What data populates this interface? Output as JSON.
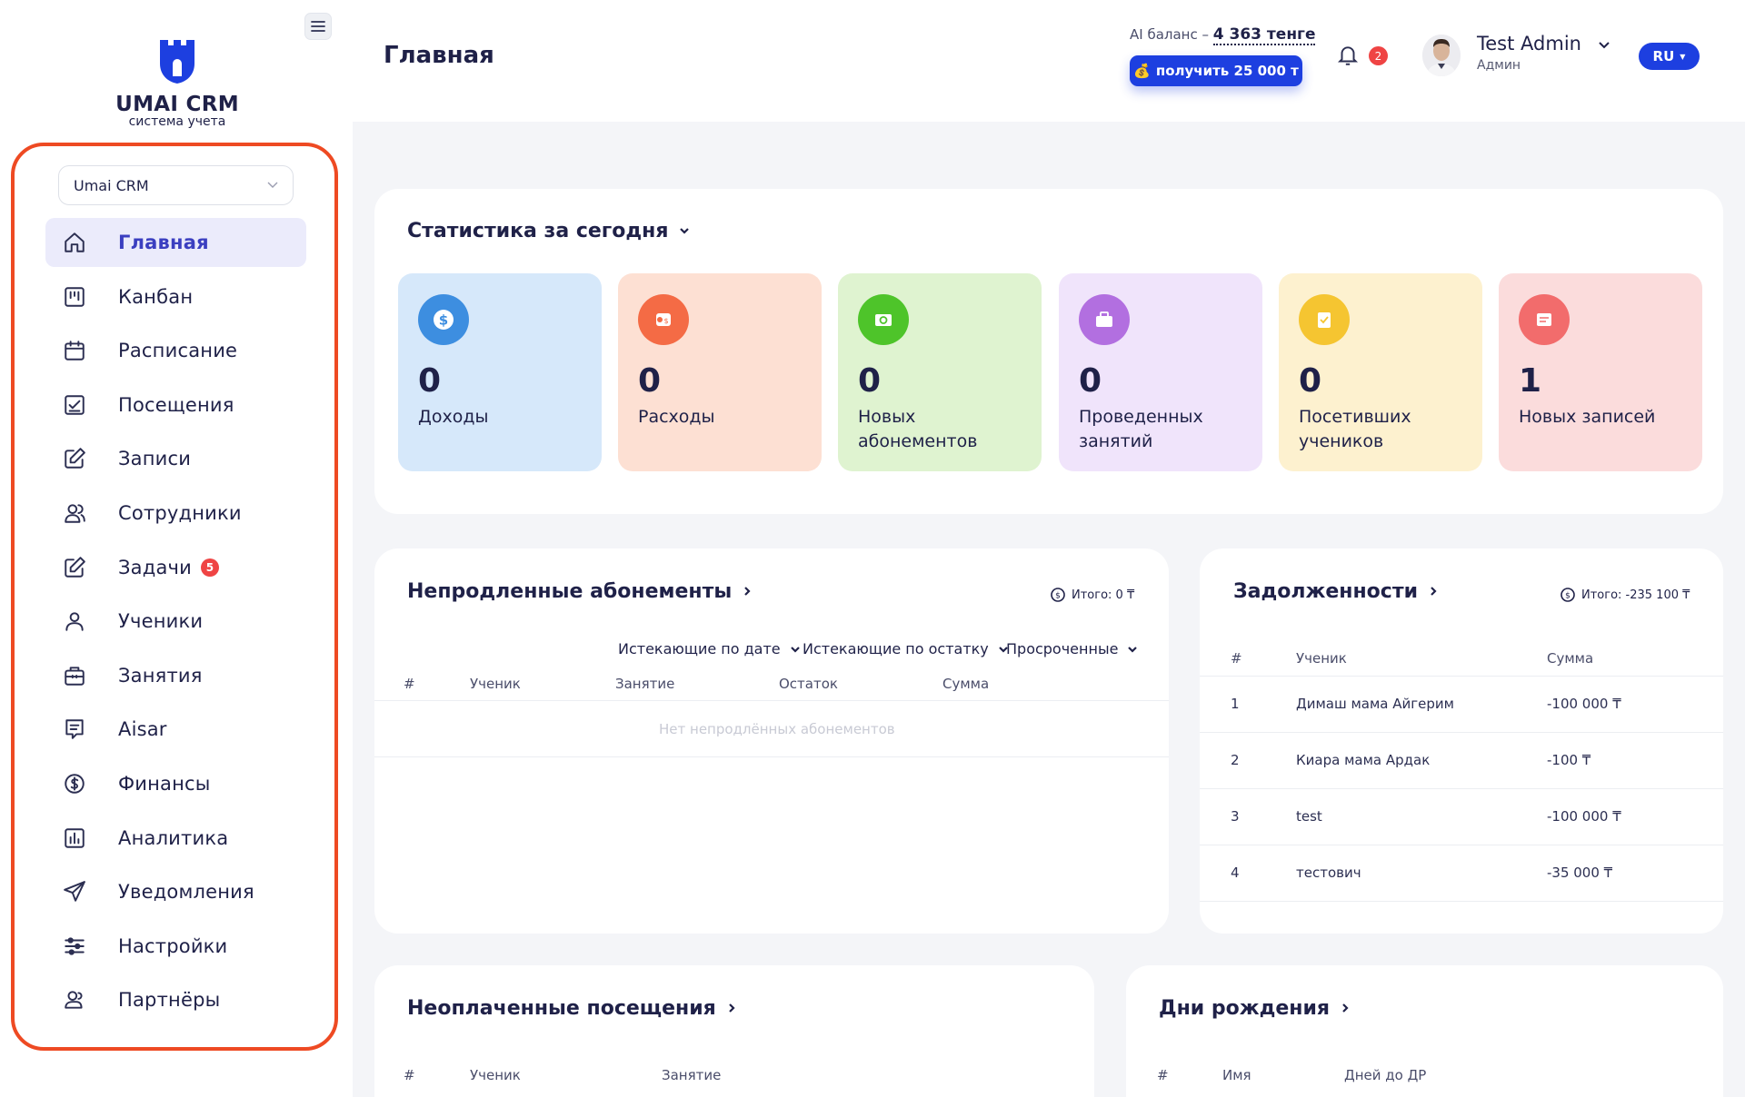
{
  "brand": {
    "name": "UMAI CRM",
    "subtitle": "система учета",
    "color": "#1d3fe0",
    "accent": "#ee4a23"
  },
  "sidebar": {
    "company": "Umai CRM",
    "items": [
      {
        "label": "Главная",
        "icon": "home-icon"
      },
      {
        "label": "Канбан",
        "icon": "kanban-icon"
      },
      {
        "label": "Расписание",
        "icon": "calendar-icon"
      },
      {
        "label": "Посещения",
        "icon": "checkbox-icon"
      },
      {
        "label": "Записи",
        "icon": "edit-icon"
      },
      {
        "label": "Сотрудники",
        "icon": "users-icon"
      },
      {
        "label": "Задачи",
        "icon": "edit-icon",
        "badge": "5"
      },
      {
        "label": "Ученики",
        "icon": "user-icon"
      },
      {
        "label": "Занятия",
        "icon": "briefcase-icon"
      },
      {
        "label": "Aisar",
        "icon": "message-icon"
      },
      {
        "label": "Финансы",
        "icon": "dollar-icon"
      },
      {
        "label": "Аналитика",
        "icon": "chart-icon"
      },
      {
        "label": "Уведомления",
        "icon": "send-icon"
      },
      {
        "label": "Настройки",
        "icon": "sliders-icon"
      },
      {
        "label": "Партнёры",
        "icon": "partners-icon"
      }
    ]
  },
  "header": {
    "title": "Главная",
    "ai_balance_label": "AI баланс –",
    "ai_balance_value": "4 363 тенге",
    "get_button": "получить 25 000 т",
    "notifications": "2",
    "user_name": "Test Admin",
    "user_role": "Админ",
    "lang": "RU"
  },
  "stats": {
    "title": "Статистика за сегодня",
    "tiles": [
      {
        "value": "0",
        "label": "Доходы",
        "bg": "#d6e8fa",
        "circle": "#3d8ee0",
        "icon": "dollar-icon"
      },
      {
        "value": "0",
        "label": "Расходы",
        "bg": "#fde0d3",
        "circle": "#f46b45",
        "icon": "receipt-icon"
      },
      {
        "value": "0",
        "label": "Новых абонементов",
        "bg": "#dff3d0",
        "circle": "#4ec42a",
        "icon": "money-icon"
      },
      {
        "value": "0",
        "label": "Проведенных занятий",
        "bg": "#f0e4fb",
        "circle": "#b26fe0",
        "icon": "briefcase-icon"
      },
      {
        "value": "0",
        "label": "Посетивших учеников",
        "bg": "#fdf1cf",
        "circle": "#f5c531",
        "icon": "clipboard-icon"
      },
      {
        "value": "1",
        "label": "Новых записей",
        "bg": "#fbdcdc",
        "circle": "#f26c6c",
        "icon": "notes-icon"
      }
    ]
  },
  "unrenewed": {
    "title": "Непродленные абонементы",
    "total": "Итого: 0 ₸",
    "filters": [
      "Истекающие по дате",
      "Истекающие по остатку",
      "Просроченные"
    ],
    "columns": [
      "#",
      "Ученик",
      "Занятие",
      "Остаток",
      "Сумма"
    ],
    "empty": "Нет непродлённых абонементов"
  },
  "debts": {
    "title": "Задолженности",
    "total": "Итого: -235 100 ₸",
    "columns": [
      "#",
      "Ученик",
      "Сумма"
    ],
    "rows": [
      {
        "n": "1",
        "name": "Димаш мама Айгерим",
        "sum": "-100 000 ₸"
      },
      {
        "n": "2",
        "name": "Киара мама Ардак",
        "sum": "-100 ₸"
      },
      {
        "n": "3",
        "name": "test",
        "sum": "-100 000 ₸"
      },
      {
        "n": "4",
        "name": "тестович",
        "sum": "-35 000 ₸"
      }
    ]
  },
  "unpaid": {
    "title": "Неоплаченные посещения",
    "columns": [
      "#",
      "Ученик",
      "Занятие"
    ]
  },
  "birthdays": {
    "title": "Дни рождения",
    "columns": [
      "#",
      "Имя",
      "Дней до ДР"
    ]
  }
}
